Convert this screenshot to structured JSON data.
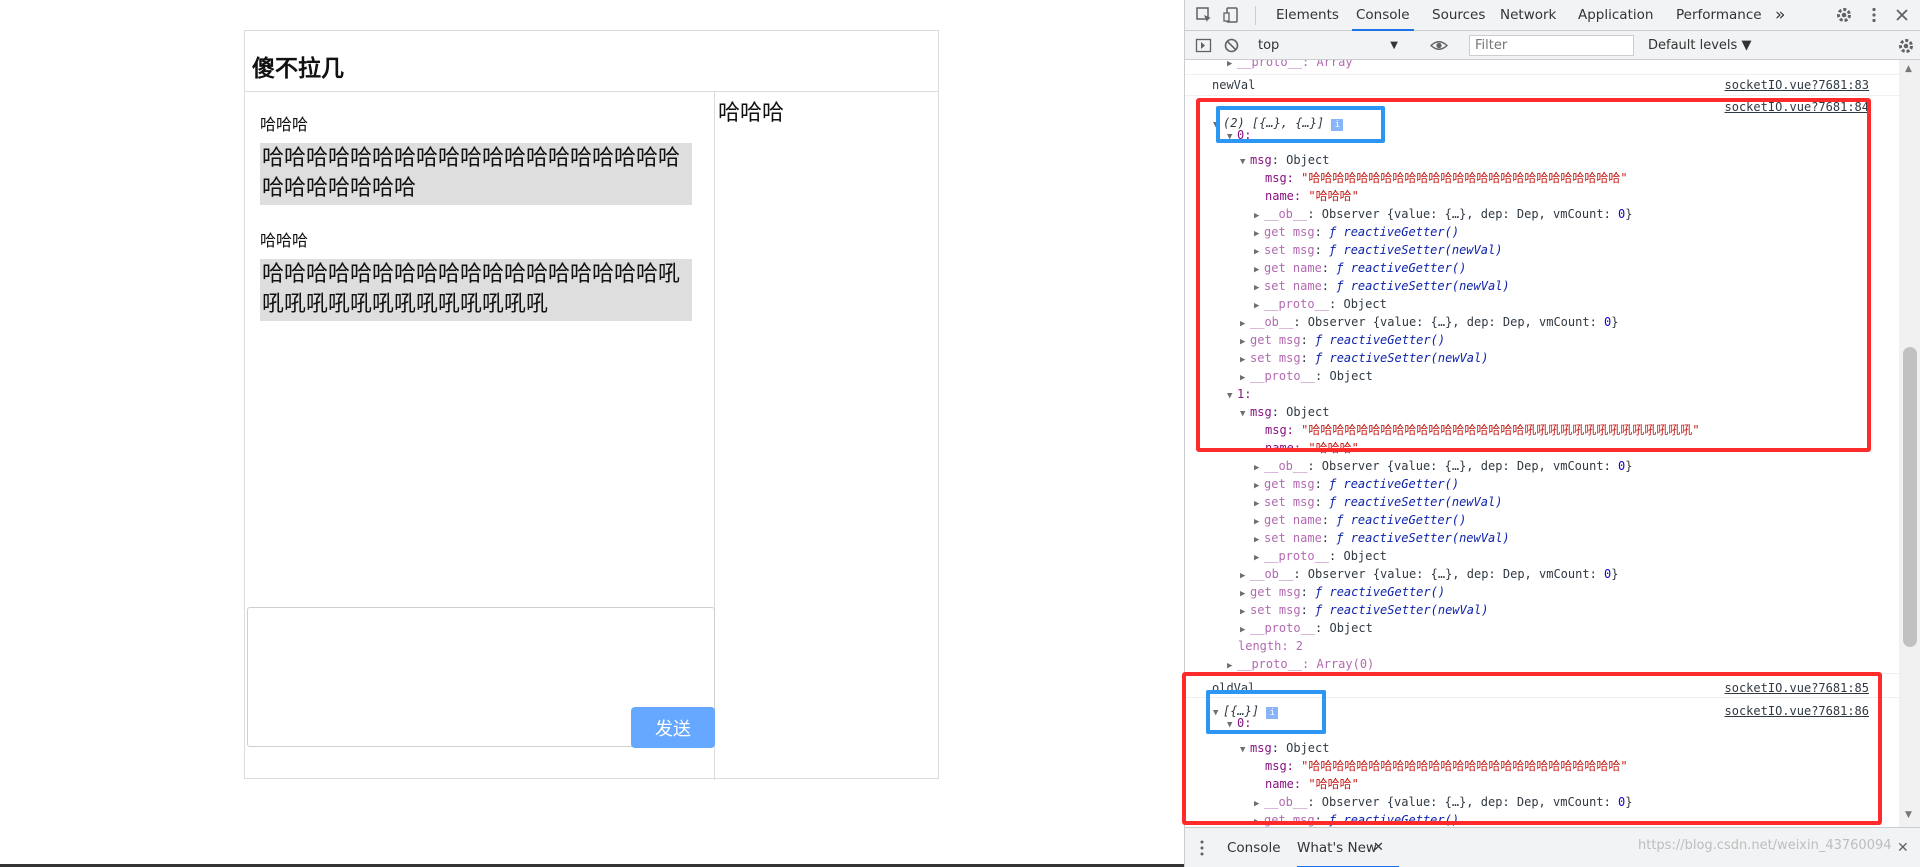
{
  "chat": {
    "title": "傻不拉几",
    "messages": [
      {
        "name": "哈哈哈",
        "text": "哈哈哈哈哈哈哈哈哈哈哈哈哈哈哈哈哈哈哈哈哈哈哈哈哈哈"
      },
      {
        "name": "哈哈哈",
        "text": "哈哈哈哈哈哈哈哈哈哈哈哈哈哈哈哈哈哈吼吼吼吼吼吼吼吼吼吼吼吼吼吼"
      }
    ],
    "side_text": "哈哈哈",
    "input_value": "",
    "send_label": "发送"
  },
  "devtools": {
    "tabs": [
      "Elements",
      "Console",
      "Sources",
      "Network",
      "Application",
      "Performance"
    ],
    "active_tab": "Console",
    "more_tabs": "»",
    "context": "top",
    "filter_placeholder": "Filter",
    "levels": "Default levels ▼",
    "console_lines": [
      {
        "t": "    ▶ __proto__: Array",
        "y": 0
      },
      {
        "t": "  newVal",
        "y": 18,
        "src": "socketIO.vue?7681:83"
      },
      {
        "t": "",
        "y": 36,
        "src": "socketIO.vue?7681:84"
      }
    ],
    "sources": {
      "l83": "socketIO.vue?7681:83",
      "l84": "socketIO.vue?7681:84",
      "l85": "socketIO.vue?7681:85",
      "l86": "socketIO.vue?7681:86"
    },
    "log": {
      "proto_array_top": "__proto__: Array",
      "newval": "newVal",
      "array_summary": "(2) [{…}, {…}]",
      "idx0": "0:",
      "idx1": "1:",
      "msg_object": "msg: Object",
      "msg_label": "msg:",
      "name_label": "name:",
      "msg_value_0": "\"哈哈哈哈哈哈哈哈哈哈哈哈哈哈哈哈哈哈哈哈哈哈哈哈哈哈\"",
      "name_value": "\"哈哈哈\"",
      "ob_line": "__ob__: Observer {value: {…}, dep: Dep, vmCount: 0}",
      "get_msg": "get msg: ƒ reactiveGetter()",
      "set_msg": "set msg: ƒ reactiveSetter(newVal)",
      "get_name": "get name: ƒ reactiveGetter()",
      "set_name": "set name: ƒ reactiveSetter(newVal)",
      "proto_object": "__proto__: Object",
      "msg_value_1": "\"哈哈哈哈哈哈哈哈哈哈哈哈哈哈哈哈哈哈吼吼吼吼吼吼吼吼吼吼吼吼吼吼\"",
      "length": "length: 2",
      "proto_array0": "__proto__: Array(0)",
      "oldval": "oldVal",
      "array_summary_1": "[{…}]"
    },
    "drawer_tabs": [
      "Console",
      "What's New"
    ],
    "watermark": "https://blog.csdn.net/weixin_43760094"
  }
}
